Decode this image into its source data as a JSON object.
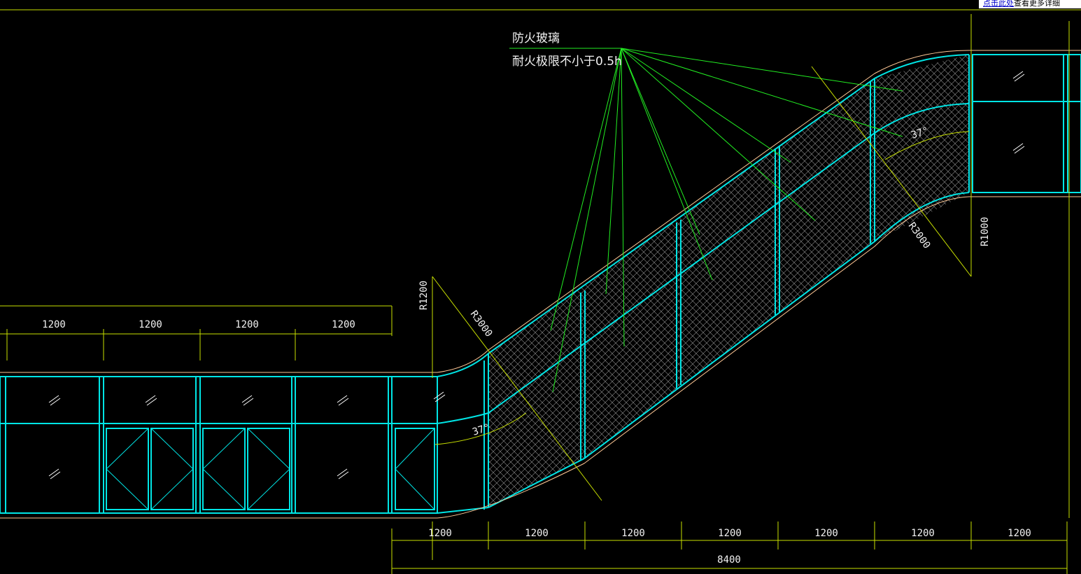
{
  "notice": {
    "link_text": "点击此处",
    "rest_text": "查看更多详细"
  },
  "annotation": {
    "line1": "防火玻璃",
    "line2": "耐火极限不小于0.5h"
  },
  "dimensions": {
    "top_row": [
      "1200",
      "1200",
      "1200",
      "1200"
    ],
    "bottom_row": [
      "1200",
      "1200",
      "1200",
      "1200",
      "1200",
      "1200",
      "1200"
    ],
    "total": "8400"
  },
  "radii": {
    "r1200": "R1200",
    "r3000_left": "R3000",
    "r3000_right": "R3000",
    "r1000": "R1000"
  },
  "angles": {
    "left": "37°",
    "right": "37°"
  },
  "colors": {
    "background": "#000000",
    "frame": "#00e5e5",
    "outline": "#ffc896",
    "leader": "#22ee22",
    "dim": "#c8e000",
    "hatch": "#cfcfcf"
  }
}
